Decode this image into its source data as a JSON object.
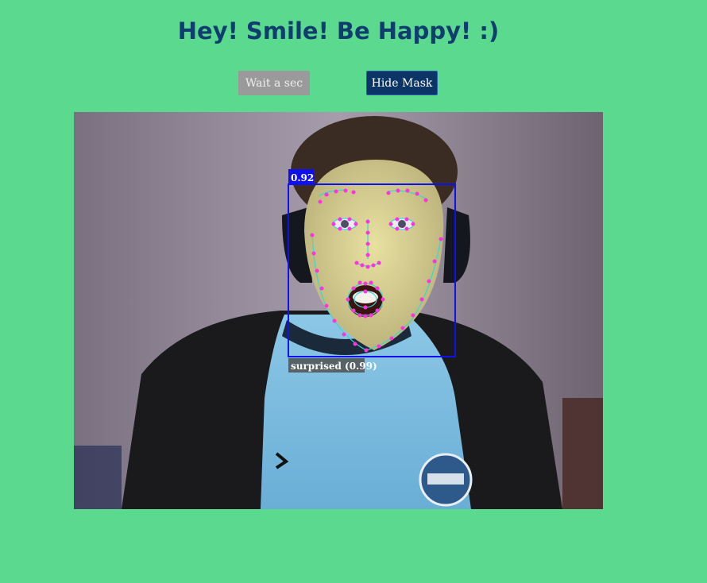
{
  "header": {
    "title": "Hey! Smile! Be Happy! :)"
  },
  "controls": {
    "wait_label": "Wait a sec",
    "mask_label": "Hide Mask"
  },
  "detection": {
    "score": "0.92",
    "expression": "surprised (0.99)"
  },
  "colors": {
    "background": "#5bd98f",
    "title": "#0f3d6e",
    "box": "#1010ee",
    "landmark": "#ff33dd",
    "mesh": "#39d8d0"
  }
}
